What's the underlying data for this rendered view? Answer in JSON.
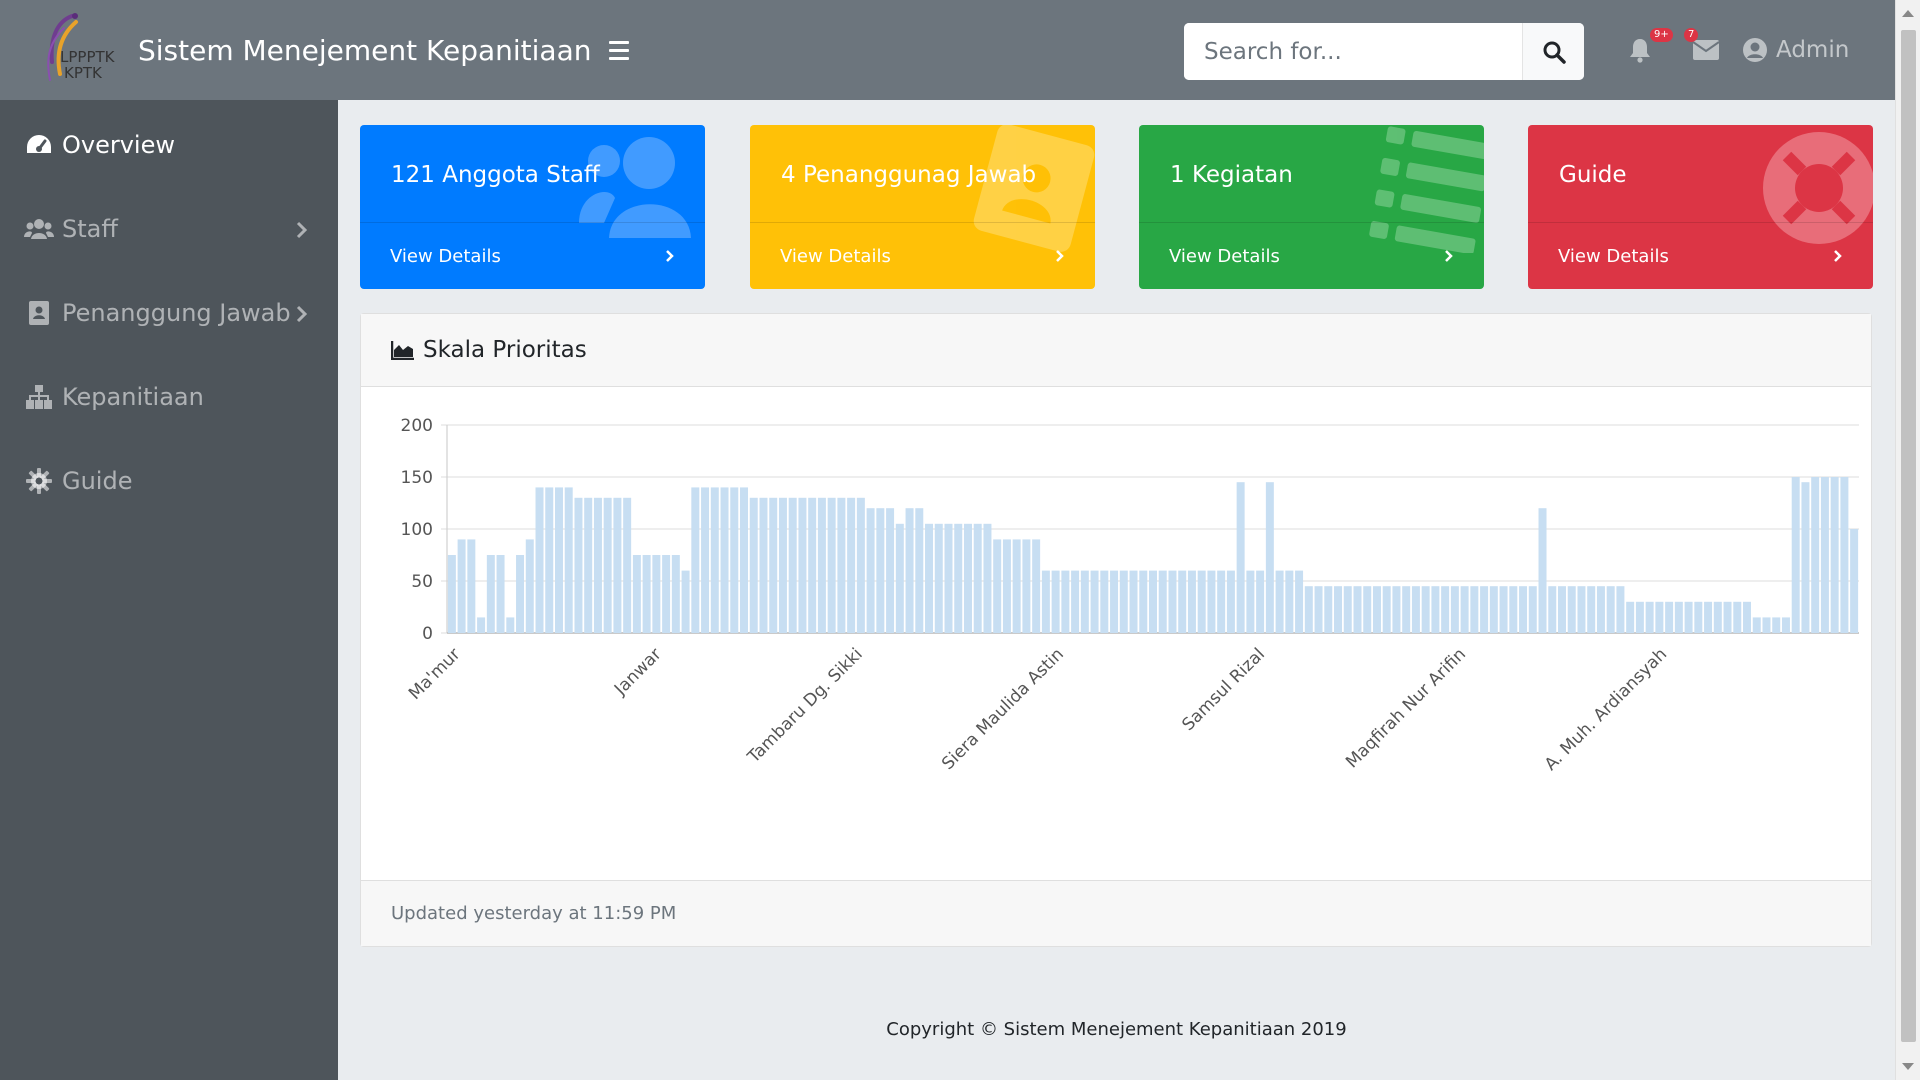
{
  "app": {
    "title": "Sistem Menejement Kepanitiaan",
    "logo_text_1": "LPPPTK",
    "logo_text_2": "KPTK"
  },
  "search": {
    "placeholder": "Search for..."
  },
  "topbar": {
    "alerts_badge": "9+",
    "messages_badge": "7",
    "user_label": "Admin"
  },
  "sidebar": {
    "items": [
      {
        "label": "Overview",
        "icon": "tachometer-icon",
        "active": true
      },
      {
        "label": "Staff",
        "icon": "users-icon",
        "has_submenu": true
      },
      {
        "label": "Penanggung Jawab",
        "icon": "address-book-icon",
        "has_submenu": true
      },
      {
        "label": "Kepanitiaan",
        "icon": "sitemap-icon"
      },
      {
        "label": "Guide",
        "icon": "cog-icon"
      }
    ]
  },
  "cards": [
    {
      "title": "121 Anggota Staff",
      "link": "View Details",
      "color": "#007bff",
      "icon": "users-icon"
    },
    {
      "title": "4 Penanggunag Jawab",
      "link": "View Details",
      "color": "#ffc107",
      "icon": "address-card-icon"
    },
    {
      "title": "1 Kegiatan",
      "link": "View Details",
      "color": "#28a745",
      "icon": "list-icon"
    },
    {
      "title": "Guide",
      "link": "View Details",
      "color": "#dc3545",
      "icon": "life-ring-icon"
    }
  ],
  "panel": {
    "title": "Skala Prioritas",
    "footer": "Updated yesterday at 11:59 PM"
  },
  "footer": {
    "copyright": "Copyright © Sistem Menejement Kepanitiaan 2019"
  },
  "chart_data": {
    "type": "bar",
    "title": "Skala Prioritas",
    "bar_color": "#c7def2",
    "grid": true,
    "ylim": [
      0,
      200
    ],
    "yticks": [
      0,
      50,
      100,
      150,
      200
    ],
    "x_tick_labels": [
      "Ma'mur",
      "Janwar",
      "Tambaru Dg. Sikki",
      "Siera Maulida Astin",
      "Samsul Rizal",
      "Maqfirah Nur Arifin",
      "A. Muh. Ardiansyah"
    ],
    "values": [
      75,
      90,
      90,
      15,
      75,
      75,
      15,
      75,
      90,
      140,
      140,
      140,
      140,
      130,
      130,
      130,
      130,
      130,
      130,
      75,
      75,
      75,
      75,
      75,
      60,
      140,
      140,
      140,
      140,
      140,
      140,
      130,
      130,
      130,
      130,
      130,
      130,
      130,
      130,
      130,
      130,
      130,
      130,
      120,
      120,
      120,
      105,
      120,
      120,
      105,
      105,
      105,
      105,
      105,
      105,
      105,
      90,
      90,
      90,
      90,
      90,
      60,
      60,
      60,
      60,
      60,
      60,
      60,
      60,
      60,
      60,
      60,
      60,
      60,
      60,
      60,
      60,
      60,
      60,
      60,
      60,
      145,
      60,
      60,
      145,
      60,
      60,
      60,
      45,
      45,
      45,
      45,
      45,
      45,
      45,
      45,
      45,
      45,
      45,
      45,
      45,
      45,
      45,
      45,
      45,
      45,
      45,
      45,
      45,
      45,
      45,
      45,
      120,
      45,
      45,
      45,
      45,
      45,
      45,
      45,
      45,
      30,
      30,
      30,
      30,
      30,
      30,
      30,
      30,
      30,
      30,
      30,
      30,
      30,
      15,
      15,
      15,
      15,
      150,
      145,
      150,
      150,
      150,
      150,
      100
    ]
  }
}
